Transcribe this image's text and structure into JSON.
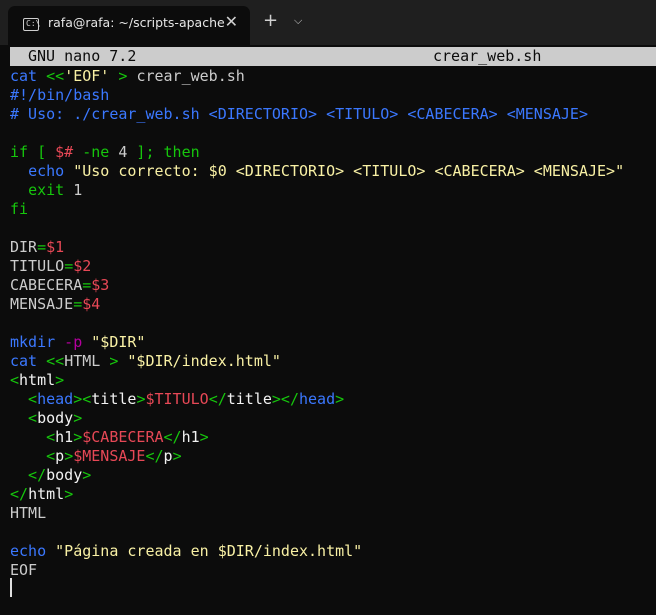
{
  "window": {
    "tab_title": "rafa@rafa: ~/scripts-apache",
    "tab_icon": "terminal-icon",
    "close_glyph": "✕",
    "new_tab_glyph": "+",
    "dropdown_glyph": "⌵"
  },
  "nano": {
    "version": "GNU nano 7.2",
    "filename": "crear_web.sh"
  },
  "lines": [
    [
      {
        "t": "cat ",
        "c": "kw"
      },
      {
        "t": "<<",
        "c": "grn"
      },
      {
        "t": "'EOF'",
        "c": "str"
      },
      {
        "t": " > ",
        "c": "grn"
      },
      {
        "t": "crear_web.sh",
        "c": ""
      }
    ],
    [
      {
        "t": "#!/bin/bash",
        "c": "cm"
      }
    ],
    [
      {
        "t": "# Uso: ./crear_web.sh <DIRECTORIO> <TITULO> <CABECERA> <MENSAJE>",
        "c": "cm"
      }
    ],
    [
      {
        "t": "",
        "c": ""
      }
    ],
    [
      {
        "t": "if",
        "c": "grn"
      },
      {
        "t": " [ ",
        "c": "grn"
      },
      {
        "t": "$#",
        "c": "red"
      },
      {
        "t": " -ne ",
        "c": "grn"
      },
      {
        "t": "4",
        "c": ""
      },
      {
        "t": " ]; then",
        "c": "grn"
      }
    ],
    [
      {
        "t": "  ",
        "c": ""
      },
      {
        "t": "echo",
        "c": "kw"
      },
      {
        "t": " \"Uso correcto: $0 <DIRECTORIO> <TITULO> <CABECERA> <MENSAJE>\"",
        "c": "str"
      }
    ],
    [
      {
        "t": "  ",
        "c": ""
      },
      {
        "t": "exit",
        "c": "grn"
      },
      {
        "t": " 1",
        "c": ""
      }
    ],
    [
      {
        "t": "fi",
        "c": "grn"
      }
    ],
    [
      {
        "t": "",
        "c": ""
      }
    ],
    [
      {
        "t": "DIR",
        "c": ""
      },
      {
        "t": "=",
        "c": "grn"
      },
      {
        "t": "$1",
        "c": "red"
      }
    ],
    [
      {
        "t": "TITULO",
        "c": ""
      },
      {
        "t": "=",
        "c": "grn"
      },
      {
        "t": "$2",
        "c": "red"
      }
    ],
    [
      {
        "t": "CABECERA",
        "c": ""
      },
      {
        "t": "=",
        "c": "grn"
      },
      {
        "t": "$3",
        "c": "red"
      }
    ],
    [
      {
        "t": "MENSAJE",
        "c": ""
      },
      {
        "t": "=",
        "c": "grn"
      },
      {
        "t": "$4",
        "c": "red"
      }
    ],
    [
      {
        "t": "",
        "c": ""
      }
    ],
    [
      {
        "t": "mkdir",
        "c": "kw"
      },
      {
        "t": " -p",
        "c": "mag"
      },
      {
        "t": " \"$DIR\"",
        "c": "str"
      }
    ],
    [
      {
        "t": "cat ",
        "c": "kw"
      },
      {
        "t": "<<",
        "c": "grn"
      },
      {
        "t": "HTML",
        "c": ""
      },
      {
        "t": " > ",
        "c": "grn"
      },
      {
        "t": "\"$DIR/index.html\"",
        "c": "str"
      }
    ],
    [
      {
        "t": "<",
        "c": "grn"
      },
      {
        "t": "html",
        "c": "wht"
      },
      {
        "t": ">",
        "c": "grn"
      }
    ],
    [
      {
        "t": "  <",
        "c": "grn"
      },
      {
        "t": "head",
        "c": "kw"
      },
      {
        "t": "><",
        "c": "grn"
      },
      {
        "t": "title",
        "c": "wht"
      },
      {
        "t": ">",
        "c": "grn"
      },
      {
        "t": "$TITULO",
        "c": "red"
      },
      {
        "t": "</",
        "c": "grn"
      },
      {
        "t": "title",
        "c": "wht"
      },
      {
        "t": "></",
        "c": "grn"
      },
      {
        "t": "head",
        "c": "kw"
      },
      {
        "t": ">",
        "c": "grn"
      }
    ],
    [
      {
        "t": "  <",
        "c": "grn"
      },
      {
        "t": "body",
        "c": "wht"
      },
      {
        "t": ">",
        "c": "grn"
      }
    ],
    [
      {
        "t": "    <",
        "c": "grn"
      },
      {
        "t": "h1",
        "c": "wht"
      },
      {
        "t": ">",
        "c": "grn"
      },
      {
        "t": "$CABECERA",
        "c": "red"
      },
      {
        "t": "</",
        "c": "grn"
      },
      {
        "t": "h1",
        "c": "wht"
      },
      {
        "t": ">",
        "c": "grn"
      }
    ],
    [
      {
        "t": "    <",
        "c": "grn"
      },
      {
        "t": "p",
        "c": "wht"
      },
      {
        "t": ">",
        "c": "grn"
      },
      {
        "t": "$MENSAJE",
        "c": "red"
      },
      {
        "t": "</",
        "c": "grn"
      },
      {
        "t": "p",
        "c": "wht"
      },
      {
        "t": ">",
        "c": "grn"
      }
    ],
    [
      {
        "t": "  </",
        "c": "grn"
      },
      {
        "t": "body",
        "c": "wht"
      },
      {
        "t": ">",
        "c": "grn"
      }
    ],
    [
      {
        "t": "</",
        "c": "grn"
      },
      {
        "t": "html",
        "c": "wht"
      },
      {
        "t": ">",
        "c": "grn"
      }
    ],
    [
      {
        "t": "HTML",
        "c": ""
      }
    ],
    [
      {
        "t": "",
        "c": ""
      }
    ],
    [
      {
        "t": "echo",
        "c": "kw"
      },
      {
        "t": " \"Página creada en $DIR/index.html\"",
        "c": "str"
      }
    ],
    [
      {
        "t": "EOF",
        "c": ""
      }
    ]
  ],
  "colors": {
    "background": "#0c0c0c",
    "keyword": "#3b78ff",
    "string": "#f9f1a5",
    "operator": "#16c60c",
    "variable": "#e74856",
    "option": "#b4009e",
    "header_bg": "#cccccc"
  }
}
